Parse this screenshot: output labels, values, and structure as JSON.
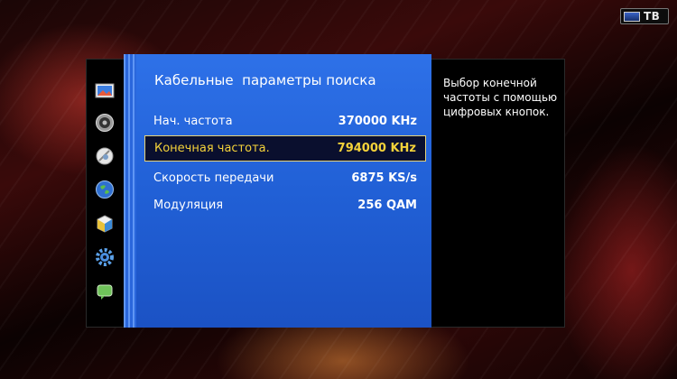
{
  "badge": {
    "label": "ТВ"
  },
  "sidebar": {
    "items": [
      {
        "icon": "picture-icon"
      },
      {
        "icon": "sound-icon"
      },
      {
        "icon": "channel-antenna-icon"
      },
      {
        "icon": "network-globe-icon"
      },
      {
        "icon": "smart-hub-cube-icon"
      },
      {
        "icon": "system-gear-icon"
      },
      {
        "icon": "support-chat-icon"
      }
    ]
  },
  "panel": {
    "title": "Кабельные  параметры поиска",
    "rows": [
      {
        "label": "Нач. частота",
        "value": "370000 KHz"
      },
      {
        "label": "Конечная частота.",
        "value": "794000 KHz",
        "selected": true
      },
      {
        "label": "Скорость передачи",
        "value": "6875 KS/s"
      },
      {
        "label": "Модуляция",
        "value": "256 QAM"
      }
    ]
  },
  "help": {
    "text": "Выбор конечной частоты с помощью цифровых кнопок."
  },
  "colors": {
    "panel": "#2160d6",
    "highlight_text": "#f4d23a",
    "highlight_border": "#e5d27a"
  }
}
